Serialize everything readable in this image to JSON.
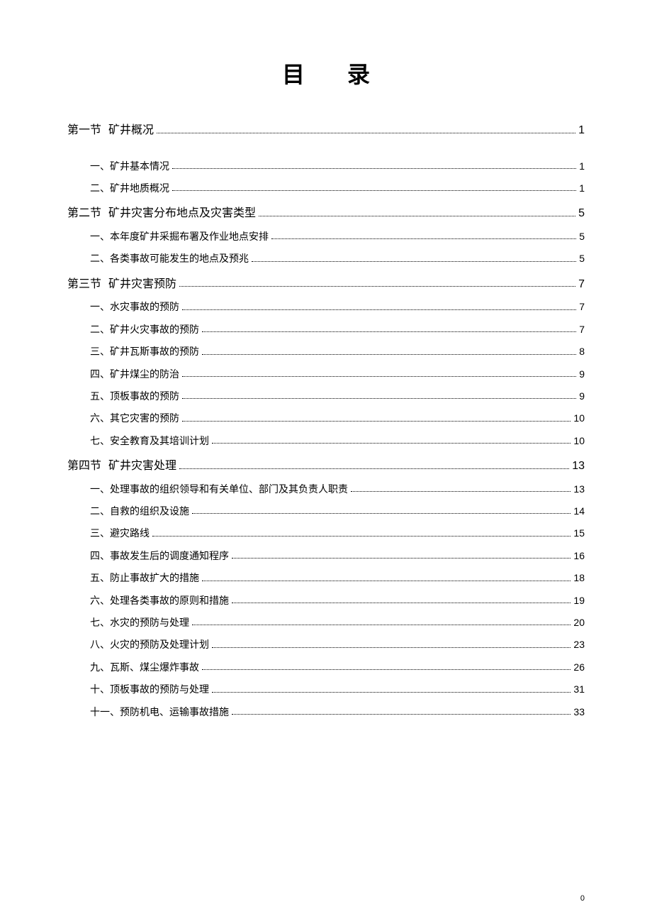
{
  "title": "目录",
  "footer_page": "0",
  "sections": [
    {
      "label": "第一节",
      "name": "矿井概况",
      "page": "1",
      "items": [
        {
          "text": "一、矿井基本情况",
          "page": "1"
        },
        {
          "text": "二、矿井地质概况",
          "page": "1"
        }
      ]
    },
    {
      "label": "第二节",
      "name": "矿井灾害分布地点及灾害类型",
      "page": "5",
      "items": [
        {
          "text": "一、本年度矿井采掘布署及作业地点安排",
          "page": "5"
        },
        {
          "text": "二、各类事故可能发生的地点及预兆",
          "page": "5"
        }
      ]
    },
    {
      "label": "第三节",
      "name": "矿井灾害预防",
      "page": "7",
      "items": [
        {
          "text": "一、水灾事故的预防",
          "page": "7"
        },
        {
          "text": "二、矿井火灾事故的预防",
          "page": "7"
        },
        {
          "text": "三、矿井瓦斯事故的预防",
          "page": "8"
        },
        {
          "text": "四、矿井煤尘的防治",
          "page": "9"
        },
        {
          "text": "五、顶板事故的预防",
          "page": "9"
        },
        {
          "text": "六、其它灾害的预防",
          "page": "10"
        },
        {
          "text": "七、安全教育及其培训计划",
          "page": "10"
        }
      ]
    },
    {
      "label": "第四节",
      "name": "矿井灾害处理",
      "page": "13",
      "items": [
        {
          "text": "一、处理事故的组织领导和有关单位、部门及其负责人职责",
          "page": "13"
        },
        {
          "text": "二、自救的组织及设施",
          "page": "14"
        },
        {
          "text": "三、避灾路线",
          "page": "15"
        },
        {
          "text": "四、事故发生后的调度通知程序",
          "page": "16"
        },
        {
          "text": "五、防止事故扩大的措施",
          "page": "18"
        },
        {
          "text": "六、处理各类事故的原则和措施",
          "page": "19"
        },
        {
          "text": "七、水灾的预防与处理",
          "page": "20"
        },
        {
          "text": "八、火灾的预防及处理计划",
          "page": "23"
        },
        {
          "text": "九、瓦斯、煤尘爆炸事故",
          "page": "26"
        },
        {
          "text": "十、顶板事故的预防与处理",
          "page": "31"
        },
        {
          "text": "十一、预防机电、运输事故措施",
          "page": "33"
        }
      ]
    }
  ]
}
